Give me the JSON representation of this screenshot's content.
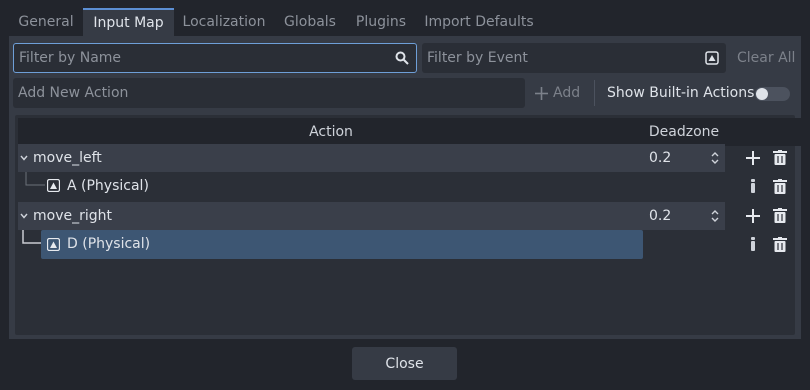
{
  "tabs": [
    {
      "label": "General"
    },
    {
      "label": "Input Map"
    },
    {
      "label": "Localization"
    },
    {
      "label": "Globals"
    },
    {
      "label": "Plugins"
    },
    {
      "label": "Import Defaults"
    }
  ],
  "active_tab": "Input Map",
  "filters": {
    "name_placeholder": "Filter by Name",
    "event_placeholder": "Filter by Event",
    "clear_all_label": "Clear All"
  },
  "add_action": {
    "placeholder": "Add New Action",
    "add_label": "Add",
    "show_builtin_label": "Show Built-in Actions",
    "show_builtin_enabled": false
  },
  "table": {
    "col_action": "Action",
    "col_deadzone": "Deadzone",
    "actions": [
      {
        "name": "move_left",
        "deadzone": "0.2",
        "events": [
          {
            "label": "A (Physical)",
            "selected": false
          }
        ]
      },
      {
        "name": "move_right",
        "deadzone": "0.2",
        "events": [
          {
            "label": "D (Physical)",
            "selected": true
          }
        ]
      }
    ]
  },
  "footer": {
    "close_label": "Close"
  },
  "colors": {
    "accent": "#5c8fd4",
    "selection": "#3d5673",
    "panel": "#363b45",
    "background": "#22252c"
  },
  "icons": [
    "search-icon",
    "keyboard-icon",
    "plus-icon",
    "trash-icon",
    "edit-icon",
    "chevron-down-icon",
    "spinner-arrows-icon"
  ]
}
